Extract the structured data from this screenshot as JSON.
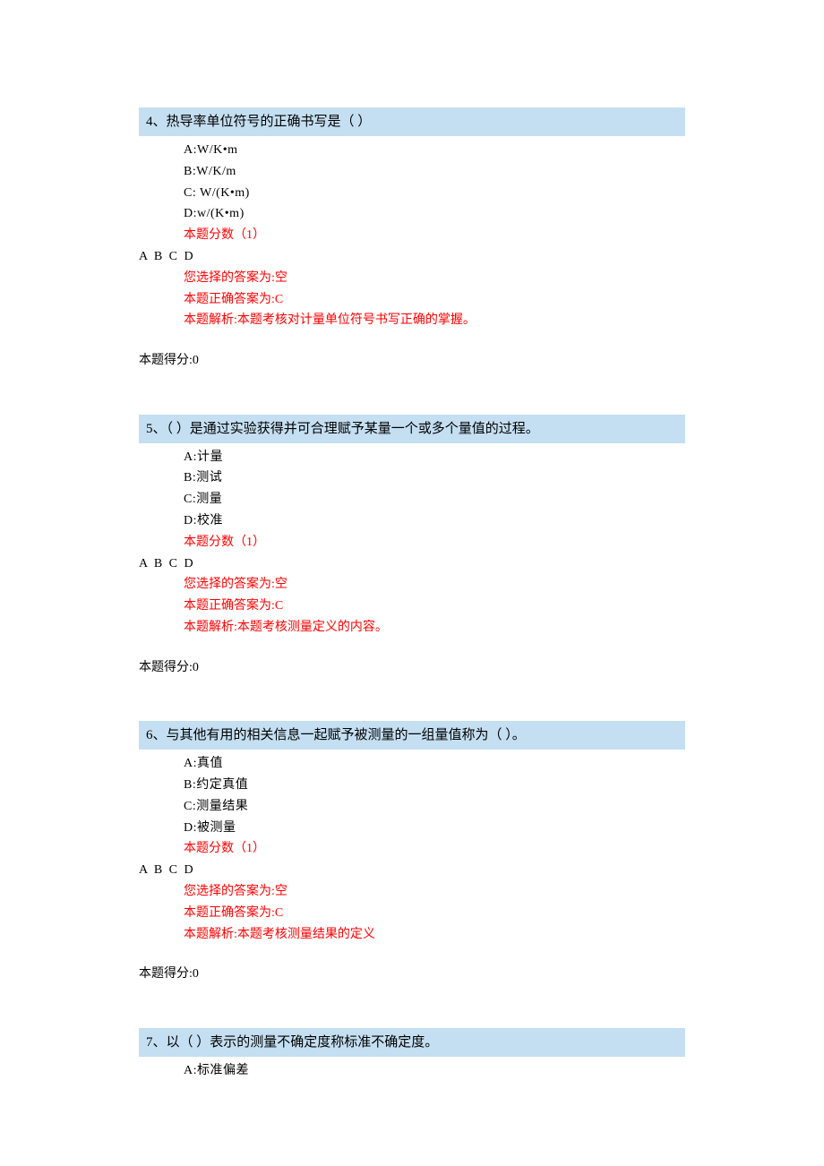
{
  "questions": [
    {
      "header": "4、热导率单位符号的正确书写是（  ）",
      "options": {
        "a": "A:W/K•m",
        "b": "B:W/K/m",
        "c": "C: W/(K•m)",
        "d": "D:w/(K•m)"
      },
      "points_label": "本题分数（1）",
      "abcd": "A B C D",
      "selected": "您选择的答案为:空",
      "correct": "本题正确答案为:C",
      "analysis": "本题解析:本题考核对计量单位符号书写正确的掌握。",
      "score": "本题得分:0"
    },
    {
      "header": "5、（  ）是通过实验获得并可合理赋予某量一个或多个量值的过程。",
      "options": {
        "a": "A:计量",
        "b": "B:测试",
        "c": "C:测量",
        "d": "D:校准"
      },
      "points_label": "本题分数（1）",
      "abcd": "A B C D",
      "selected": "您选择的答案为:空",
      "correct": "本题正确答案为:C",
      "analysis": "本题解析:本题考核测量定义的内容。",
      "score": "本题得分:0"
    },
    {
      "header": "6、与其他有用的相关信息一起赋予被测量的一组量值称为（  ）。",
      "options": {
        "a": "A:真值",
        "b": "B:约定真值",
        "c": "C:测量结果",
        "d": "D:被测量"
      },
      "points_label": "本题分数（1）",
      "abcd": "A B C D",
      "selected": "您选择的答案为:空",
      "correct": "本题正确答案为:C",
      "analysis": "本题解析:本题考核测量结果的定义",
      "score": "本题得分:0"
    },
    {
      "header": "7、以（  ）表示的测量不确定度称标准不确定度。",
      "options": {
        "a": "A:标准偏差"
      }
    }
  ]
}
